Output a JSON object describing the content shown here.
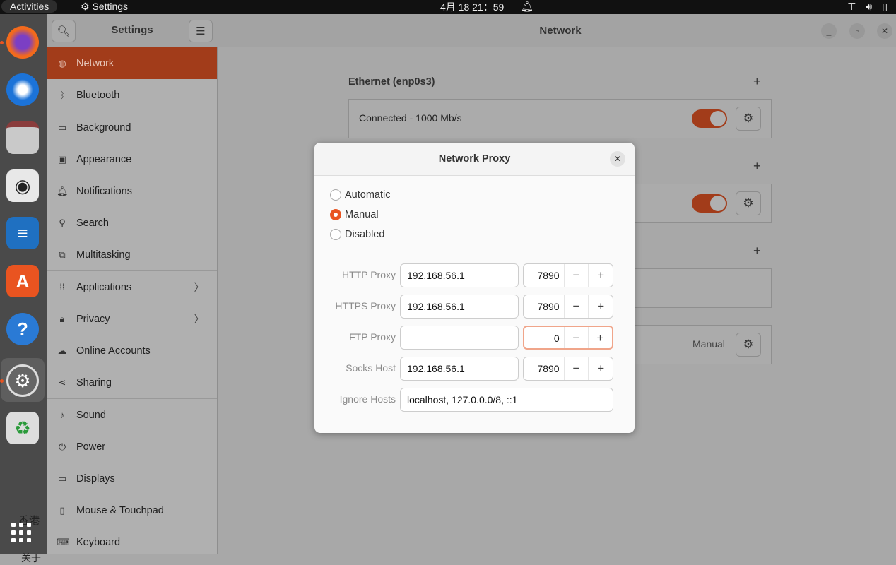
{
  "topbar": {
    "activities": "Activities",
    "app_name": "Settings",
    "clock": "4月 18  21：59"
  },
  "dock": {
    "items": [
      "firefox",
      "thunderbird",
      "files",
      "rhythmbox",
      "libreoffice-writer",
      "ubuntu-software",
      "help",
      "settings",
      "trash",
      "show-apps"
    ],
    "desktop_text_1": "香港",
    "desktop_text_2": "关于"
  },
  "sidebar": {
    "title": "Settings",
    "items": [
      {
        "label": "Network",
        "icon": "globe-icon"
      },
      {
        "label": "Bluetooth",
        "icon": "bluetooth-icon"
      },
      {
        "label": "Background",
        "icon": "monitor-icon"
      },
      {
        "label": "Appearance",
        "icon": "appearance-icon"
      },
      {
        "label": "Notifications",
        "icon": "bell-icon"
      },
      {
        "label": "Search",
        "icon": "search-icon"
      },
      {
        "label": "Multitasking",
        "icon": "multitasking-icon"
      },
      {
        "label": "Applications",
        "icon": "grid-icon"
      },
      {
        "label": "Privacy",
        "icon": "lock-icon"
      },
      {
        "label": "Online Accounts",
        "icon": "cloud-icon"
      },
      {
        "label": "Sharing",
        "icon": "share-icon"
      },
      {
        "label": "Sound",
        "icon": "music-icon"
      },
      {
        "label": "Power",
        "icon": "power-icon"
      },
      {
        "label": "Displays",
        "icon": "display-icon"
      },
      {
        "label": "Mouse & Touchpad",
        "icon": "mouse-icon"
      },
      {
        "label": "Keyboard",
        "icon": "keyboard-icon"
      }
    ]
  },
  "main": {
    "title": "Network",
    "ethernet_header": "Ethernet (enp0s3)",
    "ethernet_status": "Connected - 1000 Mb/s",
    "proxy_value": "Manual"
  },
  "dialog": {
    "title": "Network Proxy",
    "modes": [
      "Automatic",
      "Manual",
      "Disabled"
    ],
    "selected_mode": "Manual",
    "rows": [
      {
        "label": "HTTP Proxy",
        "host": "192.168.56.1",
        "port": "7890"
      },
      {
        "label": "HTTPS Proxy",
        "host": "192.168.56.1",
        "port": "7890"
      },
      {
        "label": "FTP Proxy",
        "host": "",
        "port": "0"
      },
      {
        "label": "Socks Host",
        "host": "192.168.56.1",
        "port": "7890"
      }
    ],
    "ignore_label": "Ignore Hosts",
    "ignore_value": "localhost, 127.0.0.0/8, ::1"
  },
  "colors": {
    "accent": "#e95420",
    "selected": "#a23c1a"
  }
}
